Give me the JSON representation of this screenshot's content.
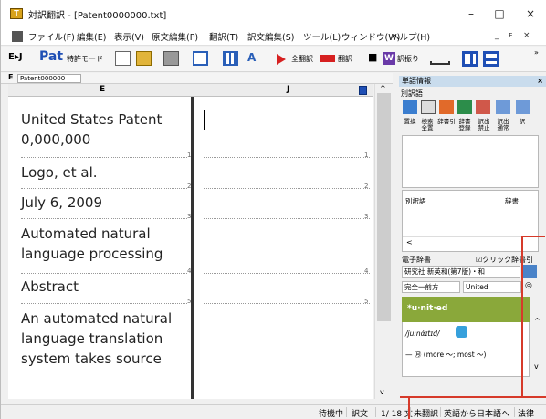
{
  "window": {
    "title": "対訳翻訳 - [Patent0000000.txt]",
    "app_icon_text": "T"
  },
  "window_controls": {
    "minimize": "–",
    "maximize": "□",
    "close": "×"
  },
  "menu": {
    "items": [
      "ファイル(F)",
      "編集(E)",
      "表示(V)",
      "原文編集(P)",
      "翻訳(T)",
      "訳文編集(S)",
      "ツール(L)",
      "ウィンドウ(W)",
      "ヘルプ(H)"
    ],
    "mdi_minimize": "_",
    "mdi_restore": "ᴇ",
    "mdi_close": "×"
  },
  "toolbar": {
    "direction": "E▸J",
    "patent_logo": "Pat",
    "patent_mode": "特許モード",
    "translate_all": "全翻訳",
    "translate": "翻訳",
    "stop": "■",
    "yakufuri": "訳振り",
    "chevron": "»"
  },
  "document": {
    "tab_label": "E",
    "doc_name": "Patent000000",
    "col_source": "E",
    "col_target": "J",
    "segments": [
      {
        "lines": [
          "United States Patent",
          "0,000,000"
        ],
        "num": "1"
      },
      {
        "lines": [
          "Logo, et al."
        ],
        "num": "2"
      },
      {
        "lines": [
          "July 6, 2009"
        ],
        "num": "3"
      },
      {
        "lines": [
          "Automated natural",
          "language processing"
        ],
        "num": "4"
      },
      {
        "lines": [
          "Abstract"
        ],
        "num": "5"
      },
      {
        "lines": [
          "An automated natural",
          "language translation",
          "system takes source"
        ],
        "num": ""
      }
    ]
  },
  "panel": {
    "word_info": "単語情報",
    "alt_words": "別訳語",
    "close": "×",
    "tools": [
      "置換",
      "検索\n全置",
      "辞書引",
      "辞書\n登録",
      "訳出\n禁止",
      "訳出\n通常",
      "訳"
    ],
    "alt_word_label": "別訳語",
    "dictionary_label": "辞書",
    "edict_title": "電子辞書",
    "click_lookup": "☑クリック辞書引",
    "dict_name": "研究社 新英和(第7版)・和",
    "match_mode": "完全一前方",
    "search_word": "United",
    "headword": "*u·nit·ed",
    "pronunciation": "/juːnάɪtɪd/",
    "comparative": "— ㊊ (more 〜; most 〜)"
  },
  "status": {
    "items": [
      "待機中",
      "訳文",
      "1/ 18 文",
      "未翻訳",
      "英語から日本語へ",
      "法律"
    ]
  },
  "colors": {
    "accent_red": "#d63a2a",
    "dict_green": "#8aa83a",
    "panel_title": "#c9dced"
  }
}
